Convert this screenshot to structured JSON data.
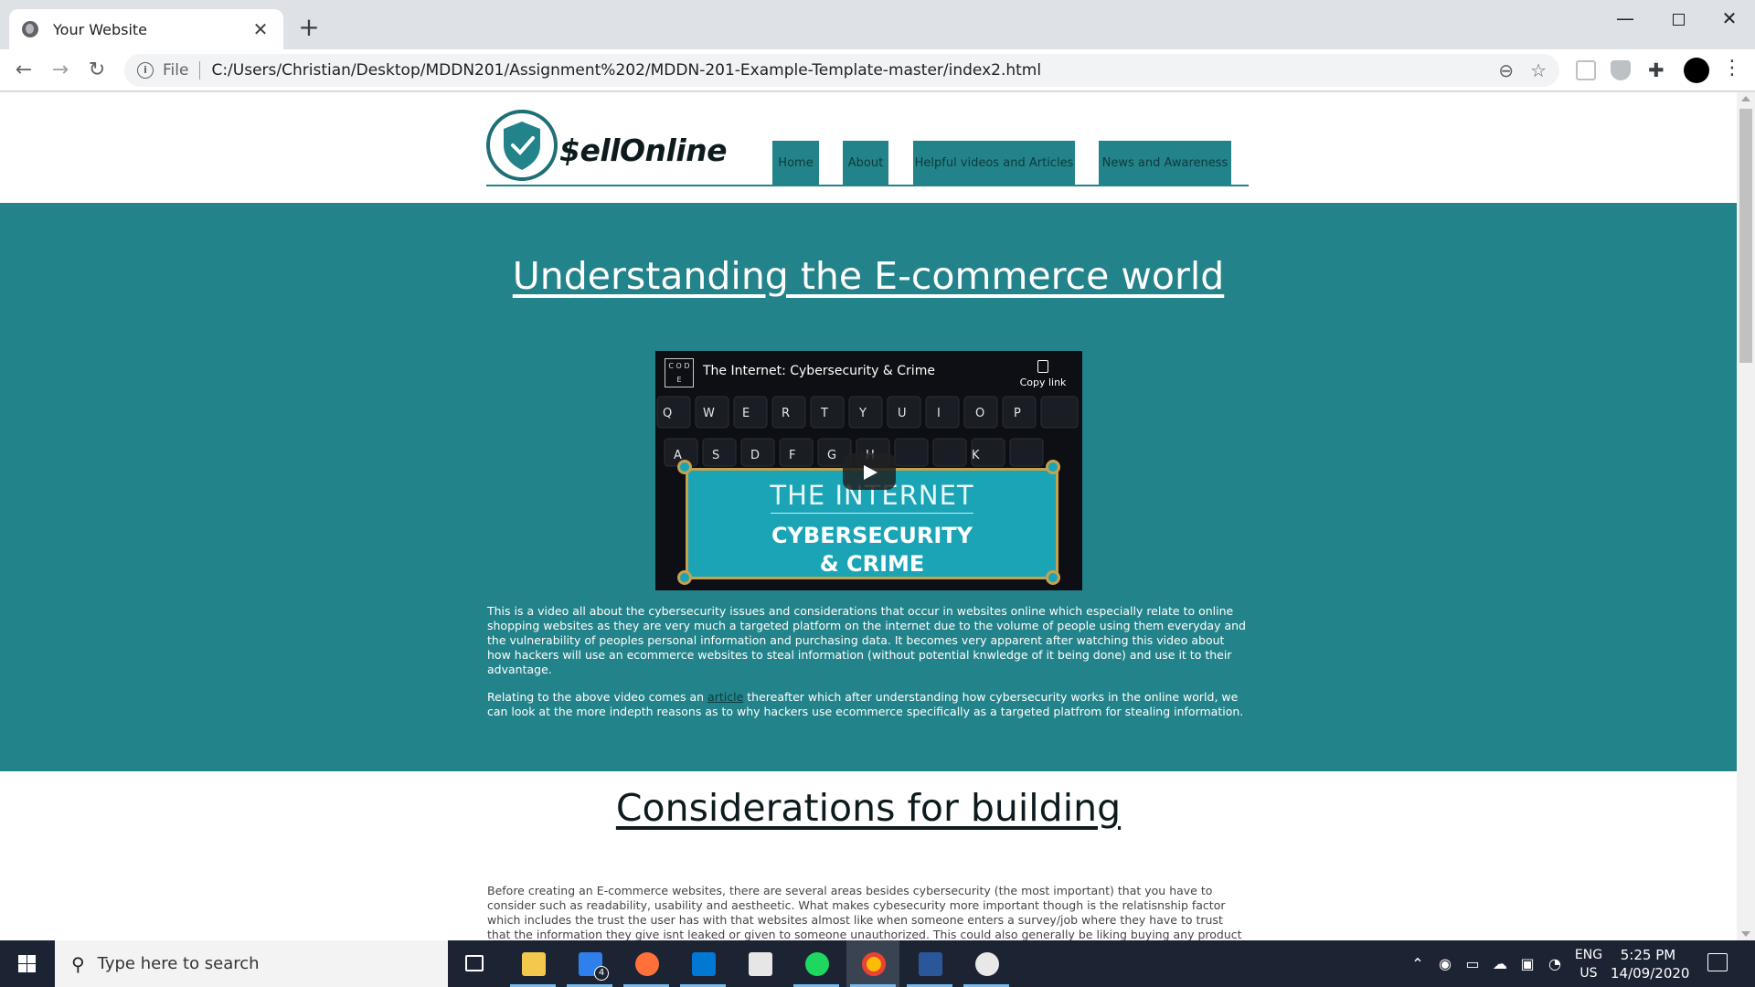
{
  "browser": {
    "tab_title": "Your Website",
    "url_scheme": "File",
    "url": "C:/Users/Christian/Desktop/MDDN201/Assignment%202/MDDN-201-Example-Template-master/index2.html"
  },
  "site": {
    "logo_text": "$ellOnline",
    "nav": [
      "Home",
      "About",
      "Helpful videos and Articles",
      "News and Awareness"
    ],
    "section1_title": "Understanding the E-commerce world",
    "video": {
      "title": "The Internet: Cybersecurity & Crime",
      "copy_link": "Copy link",
      "banner_line1": "THE INTERNET",
      "banner_line2": "CYBERSECURITY",
      "banner_line3": "& CRIME",
      "channel_logo": "C O D E"
    },
    "paragraph1": "This is a video all about the cybersecurity issues and considerations that occur in websites online which especially relate to online shopping websites as they are very much a targeted platform on the internet due to the volume of people using them everyday and the vulnerability of peoples personal information and purchasing data. It becomes very apparent after watching this video about how hackers will use an ecommerce websites to steal information (without potential knwledge of it being done) and use it to their advantage.",
    "paragraph2_before": "Relating to the above video comes an",
    "paragraph2_link": "article",
    "paragraph2_after": "thereafter which after understanding how cybersecurity works in the online world, we can look at the more indepth reasons as to why hackers use ecommerce specifically as a targeted platfrom for stealing information.",
    "section2_title": "Considerations for building",
    "paragraph3": "Before creating an E-commerce websites, there are several areas besides cybersecurity (the most important) that you have to consider such as readability, usability and aestheetic. What makes cybesecurity more important though is the relatisnship factor which includes the trust the user has with that websites almost like when someone enters a survey/job where they have to trust that the information they give isnt leaked or given to someone unauthorized. This could also generally be liking buying any product where people dont want"
  },
  "taskbar": {
    "search_placeholder": "Type here to search",
    "mail_badge": "4",
    "lang_line1": "ENG",
    "lang_line2": "US",
    "time": "5:25 PM",
    "date": "14/09/2020"
  },
  "colors": {
    "teal": "#23838a",
    "taskbar": "#1c2433",
    "banner": "#1aa4b6"
  }
}
